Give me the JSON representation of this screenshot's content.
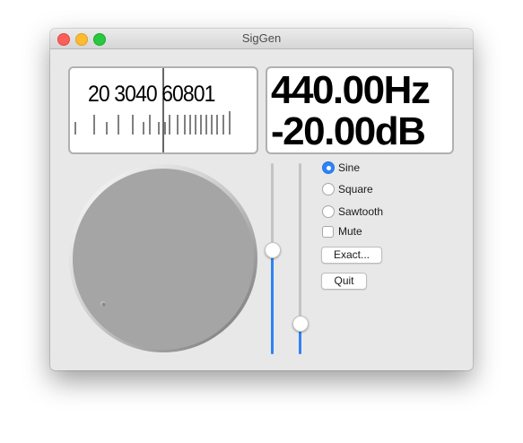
{
  "window": {
    "title": "SigGen"
  },
  "frequency_scale": {
    "labels": "20  3040  60801"
  },
  "readout": {
    "frequency": "440.00Hz",
    "level": "-20.00dB"
  },
  "sliders": {
    "slider_1_fraction": 0.55,
    "slider_2_fraction": 0.13
  },
  "waveform": {
    "options": [
      {
        "label": "Sine",
        "selected": true
      },
      {
        "label": "Square",
        "selected": false
      },
      {
        "label": "Sawtooth",
        "selected": false
      }
    ]
  },
  "mute": {
    "label": "Mute",
    "checked": false
  },
  "buttons": {
    "exact_label": "Exact...",
    "quit_label": "Quit"
  },
  "colors": {
    "accent": "#2f83f5",
    "knob": "#a5a5a5"
  }
}
